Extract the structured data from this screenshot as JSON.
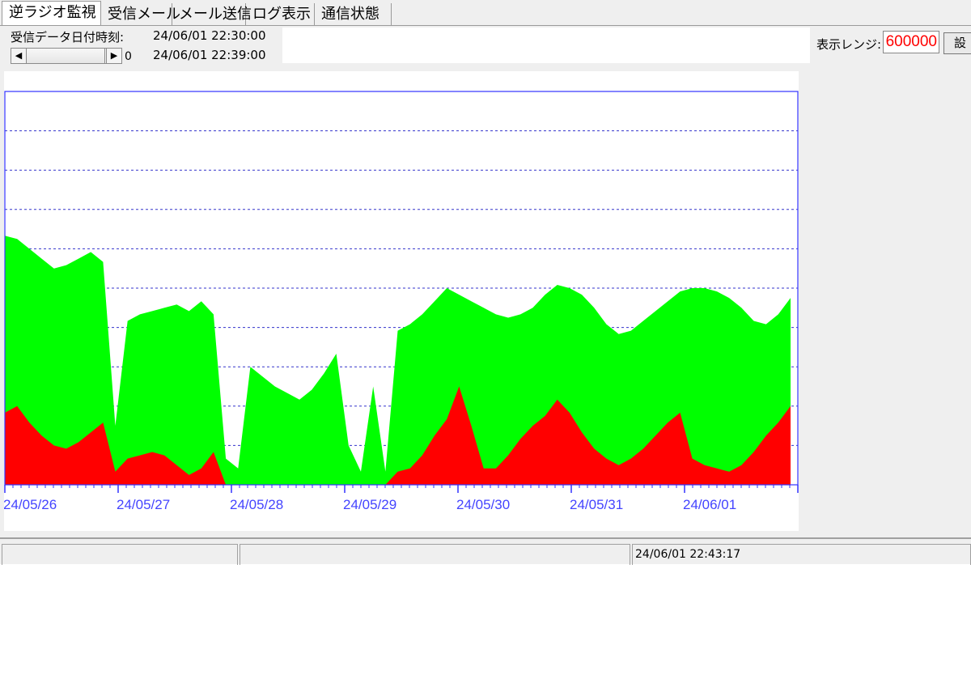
{
  "tabs": [
    {
      "label": "逆ラジオ監視",
      "active": true
    },
    {
      "label": "受信メール",
      "active": false
    },
    {
      "label": "メール送信",
      "active": false
    },
    {
      "label": "ログ表示",
      "active": false
    },
    {
      "label": "通信状態",
      "active": false
    }
  ],
  "info": {
    "received_label": "受信データ日付時刻:",
    "received_time_1": "24/06/01 22:30:00",
    "received_time_2": "24/06/01 22:39:00",
    "slider_value": "0"
  },
  "range": {
    "label": "表示レンジ:",
    "value": "600000",
    "button_label": "設"
  },
  "status": {
    "timestamp": "24/06/01 22:43:17"
  },
  "colors": {
    "green_series": "#00ff00",
    "red_series": "#ff0000",
    "axis": "#3333ff",
    "range_text": "#ff0000"
  },
  "chart_data": {
    "type": "area",
    "x": [
      "24/05/26",
      "24/05/27",
      "24/05/28",
      "24/05/29",
      "24/05/30",
      "24/05/31",
      "24/06/01"
    ],
    "y_max": 600000,
    "grid": "dotted horizontal",
    "series": [
      {
        "name": "",
        "color": "green",
        "values": [
          380000,
          375000,
          360000,
          345000,
          330000,
          335000,
          345000,
          355000,
          340000,
          90000,
          250000,
          260000,
          265000,
          270000,
          275000,
          265000,
          280000,
          260000,
          40000,
          25000,
          180000,
          165000,
          150000,
          140000,
          130000,
          145000,
          170000,
          200000,
          60000,
          20000,
          150000,
          20000,
          235000,
          245000,
          260000,
          280000,
          300000,
          290000,
          280000,
          270000,
          260000,
          255000,
          260000,
          270000,
          290000,
          305000,
          300000,
          290000,
          270000,
          245000,
          230000,
          235000,
          250000,
          265000,
          280000,
          295000,
          300000,
          300000,
          295000,
          285000,
          270000,
          250000,
          245000,
          260000,
          285000
        ]
      },
      {
        "name": "",
        "color": "red",
        "values": [
          110000,
          120000,
          95000,
          75000,
          60000,
          55000,
          65000,
          80000,
          95000,
          20000,
          40000,
          45000,
          50000,
          45000,
          30000,
          15000,
          25000,
          50000,
          0,
          0,
          0,
          0,
          0,
          0,
          0,
          0,
          0,
          0,
          0,
          0,
          0,
          0,
          20000,
          25000,
          45000,
          75000,
          100000,
          150000,
          90000,
          25000,
          25000,
          45000,
          70000,
          90000,
          105000,
          130000,
          110000,
          80000,
          55000,
          40000,
          30000,
          40000,
          55000,
          75000,
          95000,
          110000,
          40000,
          30000,
          25000,
          20000,
          30000,
          50000,
          75000,
          95000,
          120000
        ]
      }
    ]
  }
}
